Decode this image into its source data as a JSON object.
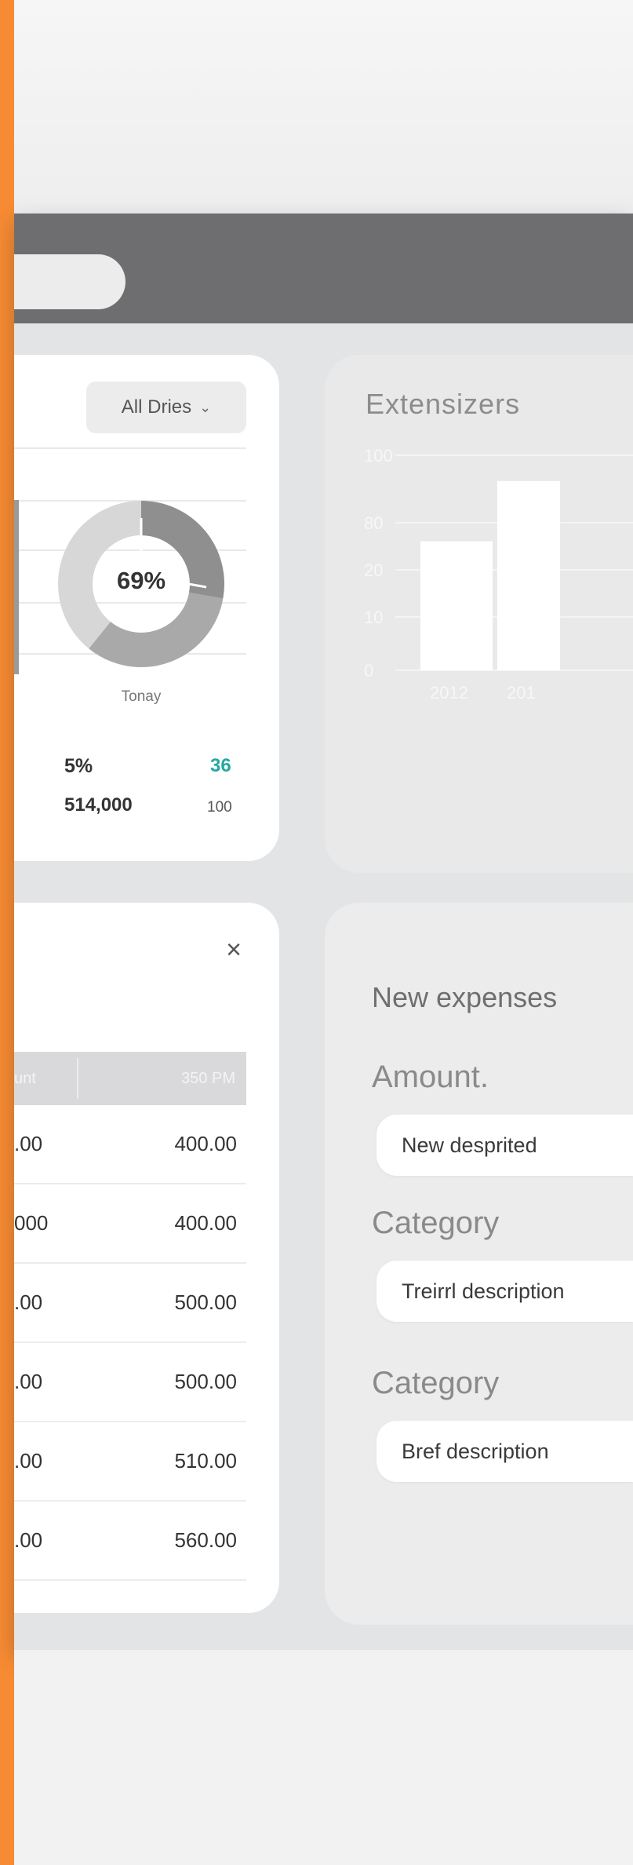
{
  "colors": {
    "accent": "#f68b33",
    "header": "#6e6e70",
    "teal": "#26a7a0",
    "donut_dark": "#8f8f8f",
    "donut_mid": "#a9a9a9",
    "donut_light": "#d7d7d7"
  },
  "overview_card": {
    "filter_label": "All Dries",
    "filter_icon": "chevron-down-icon",
    "donut_value": "69%",
    "donut_caption": "Tonay",
    "stat_percent": "5%",
    "stat_amount": "514,000",
    "stat_teal": "36",
    "stat_small": "100"
  },
  "chart_card": {
    "title": "Extensizers"
  },
  "chart_data": {
    "type": "bar",
    "title": "Extensizers",
    "categories": [
      "2012",
      "201"
    ],
    "values": [
      60,
      88
    ],
    "y_ticks": [
      "100",
      "80",
      "20",
      "10",
      "0"
    ],
    "grid": true
  },
  "table_card": {
    "close_icon": "close-icon",
    "headers": [
      "unt",
      "350 PM"
    ],
    "rows": [
      {
        "left": ".00",
        "right": "400.00"
      },
      {
        "left": "000",
        "right": "400.00"
      },
      {
        "left": ".00",
        "right": "500.00"
      },
      {
        "left": ".00",
        "right": "500.00"
      },
      {
        "left": ".00",
        "right": "510.00"
      },
      {
        "left": ".00",
        "right": "560.00"
      }
    ]
  },
  "form_card": {
    "title": "New expenses",
    "fields": [
      {
        "label": "Amount.",
        "value": "New desprited"
      },
      {
        "label": "Category",
        "value": "Treirrl description"
      },
      {
        "label": "Category",
        "value": "Bref description"
      }
    ]
  }
}
